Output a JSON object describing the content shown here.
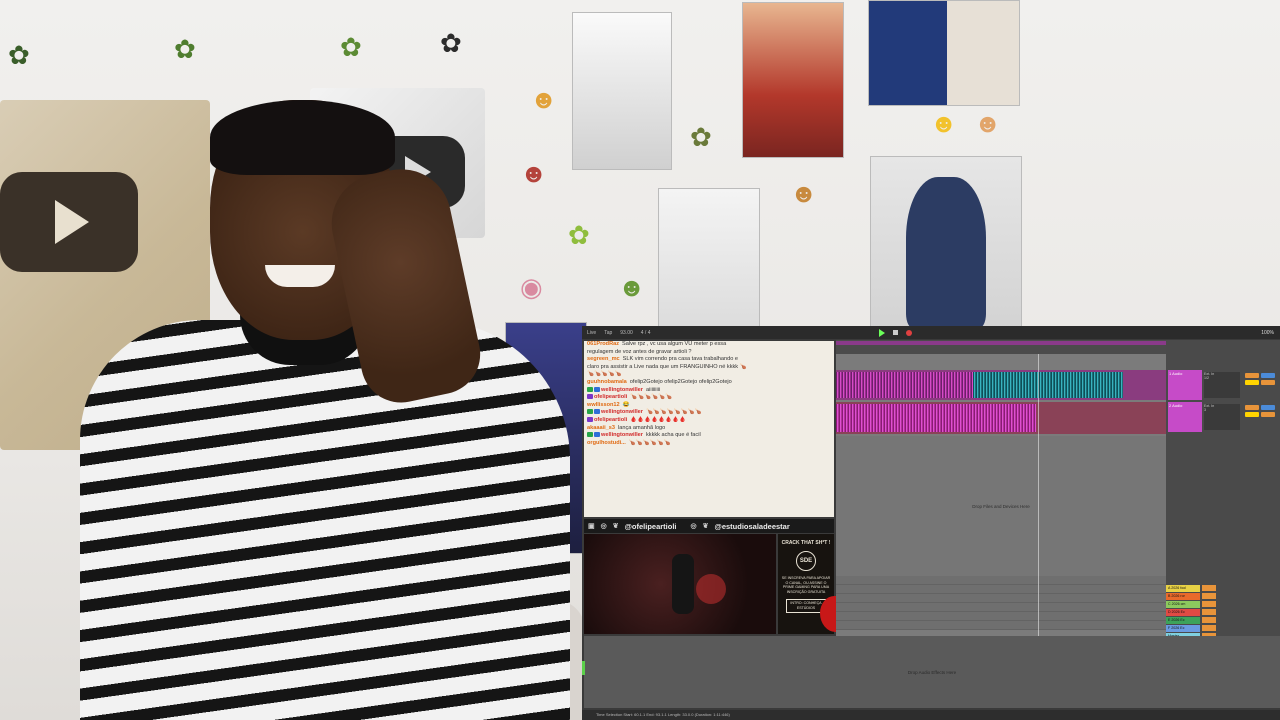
{
  "daw": {
    "app_menu": "Live",
    "tempo_label": "Tap",
    "tempo": "93.00",
    "signature": "4 / 4",
    "cpu": "100%",
    "drop_files_main": "Drop Files and Devices Here",
    "drop_audio_effects": "Drop Audio Effects Here",
    "status_bar": "Time Selection  Start: 60.1.1  End: 93.1.1  Length: 33.0.0 (Duration: 1:11:446)"
  },
  "chat": {
    "messages": [
      {
        "user": "061ProdRaz",
        "color": "orange",
        "text": "Salve rpz , vc usa algum VU meter p essa"
      },
      {
        "user": "",
        "color": "",
        "text": "regulagem de voz antes de gravar artioli ?"
      },
      {
        "user": "segreen_mc",
        "color": "orange",
        "text": "SLK vim correndo pra casa tava trabalhando e"
      },
      {
        "user": "",
        "color": "",
        "text": "claro pra assistir a Live nada que um FRANGUINHO né kkkk 🍗"
      },
      {
        "user": "",
        "color": "",
        "text": "🍗🍗🍗🍗🍗"
      },
      {
        "user": "guuhnobamala",
        "color": "orange",
        "text": "ofelip2Gotejo ofelip2Gotejo ofelip2Gotejo"
      },
      {
        "user": "wellingtonwiller",
        "color": "red",
        "text": "aiiiiiiiii",
        "badges": [
          "green",
          "blue"
        ]
      },
      {
        "user": "ofelipeartioli",
        "color": "red",
        "text": "🍗🍗🍗🍗🍗🍗",
        "badges": [
          "purple"
        ]
      },
      {
        "user": "wwllisson12",
        "color": "orange",
        "text": "😂"
      },
      {
        "user": "wellingtonwiller",
        "color": "red",
        "text": "🍗🍗🍗🍗🍗🍗🍗🍗",
        "badges": [
          "green",
          "blue"
        ]
      },
      {
        "user": "ofelipeartioli",
        "color": "red",
        "text": "🩸🩸🩸🩸🩸🩸🩸🩸",
        "badges": [
          "purple"
        ]
      },
      {
        "user": "akaaaii_s3",
        "color": "orange",
        "text": "lança amanhã logo"
      },
      {
        "user": "wellingtonwiller",
        "color": "red",
        "text": "kkkkk acha que é facil",
        "badges": [
          "green",
          "blue"
        ]
      },
      {
        "user": "orgulhostudi...",
        "color": "orange",
        "text": "🍗🍗🍗🍗🍗🍗"
      }
    ]
  },
  "socials": {
    "handle1": "@ofelipeartioli",
    "handle2": "@estudiosaladeestar"
  },
  "promo": {
    "crack": "CRACK THAT SH*T !",
    "logo": "SDE",
    "description": "SE INSCREVA PARA APOIAR O CANAL, OU ASSINE O PRIME GAMING PARA UMA INSCRIÇÃO GRATUITA",
    "cta": "INTRO: CONHEÇA ESTÚDIOS"
  },
  "mixer": {
    "tracks": [
      {
        "name": "1 Audio",
        "input": "Ext. In",
        "io2": "1/2"
      },
      {
        "name": "2 Audio",
        "input": "Ext. In",
        "io2": "3"
      }
    ],
    "returns": [
      "A 2026 fool",
      "B 2026 ror",
      "C 2026 cm",
      "D 2026 Ec",
      "E 2026 Ec",
      "F 2026 Ec",
      "Master"
    ]
  },
  "colors": {
    "clip_magenta": "#d64cc8",
    "clip_teal": "#38b3bf",
    "play_green": "#6cff5a",
    "accent_orange": "#e8943a"
  }
}
